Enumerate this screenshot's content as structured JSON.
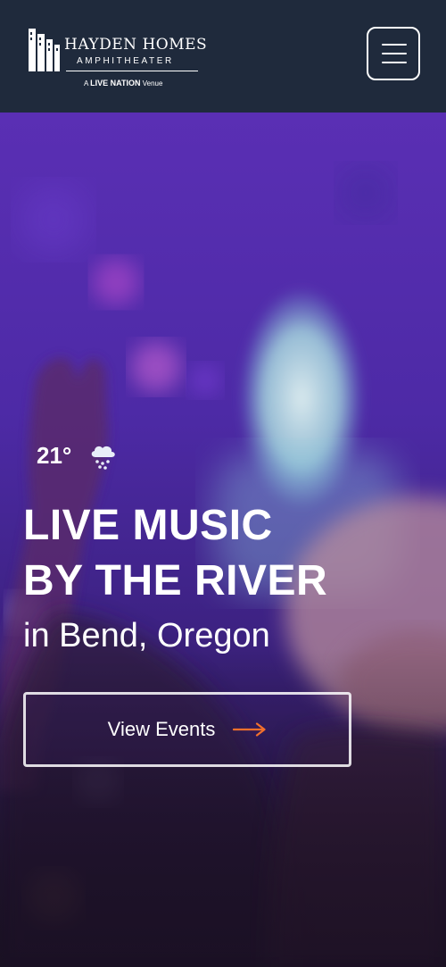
{
  "header": {
    "logo": {
      "title": "HAYDEN HOMES",
      "subtitle": "AMPHITHEATER",
      "venue_prefix": "A",
      "venue_brand": "LIVE NATION",
      "venue_suffix": "Venue"
    },
    "menu_icon": "hamburger-menu-icon"
  },
  "hero": {
    "weather": {
      "temperature": "21°",
      "icon": "snow-cloud-icon"
    },
    "headline_line1": "LIVE MUSIC",
    "headline_line2": "BY THE RIVER",
    "subheadline": "in Bend, Oregon",
    "cta": {
      "label": "View Events",
      "icon": "arrow-right-icon",
      "arrow_color": "#f2702c"
    }
  },
  "colors": {
    "header_bg": "#1f2a3c",
    "hero_tint": "#5a2fb4",
    "text": "#ffffff"
  }
}
